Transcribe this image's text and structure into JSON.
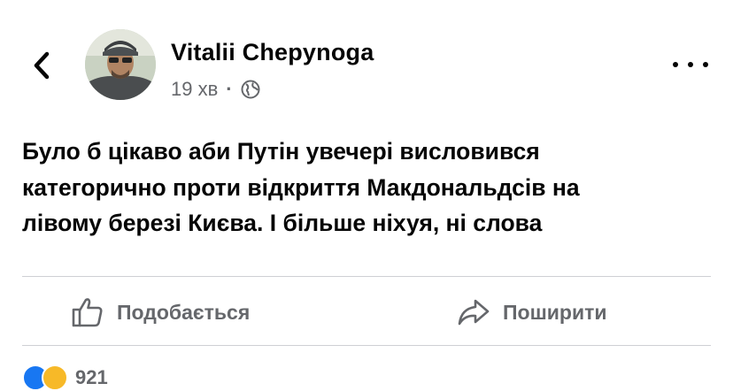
{
  "post": {
    "author": "Vitalii Chepynoga",
    "time": "19 хв",
    "separator": "·",
    "audience_icon": "globe-icon",
    "text_lines": [
      "Було б цікаво аби Путін увечері висловився",
      "категорично проти відкриття Макдональдсів на",
      "лівому березі Києва. І більше ніхуя, ні слова"
    ]
  },
  "actions": {
    "like_label": "Подобається",
    "share_label": "Поширити"
  },
  "reactions": {
    "count": "921"
  },
  "icons": {
    "back": "chevron-left-icon",
    "more": "more-dots-icon",
    "like": "thumbs-up-icon",
    "share": "share-arrow-icon"
  },
  "colors": {
    "text_primary": "#050505",
    "text_secondary": "#65676b",
    "divider": "#ced0d4"
  }
}
